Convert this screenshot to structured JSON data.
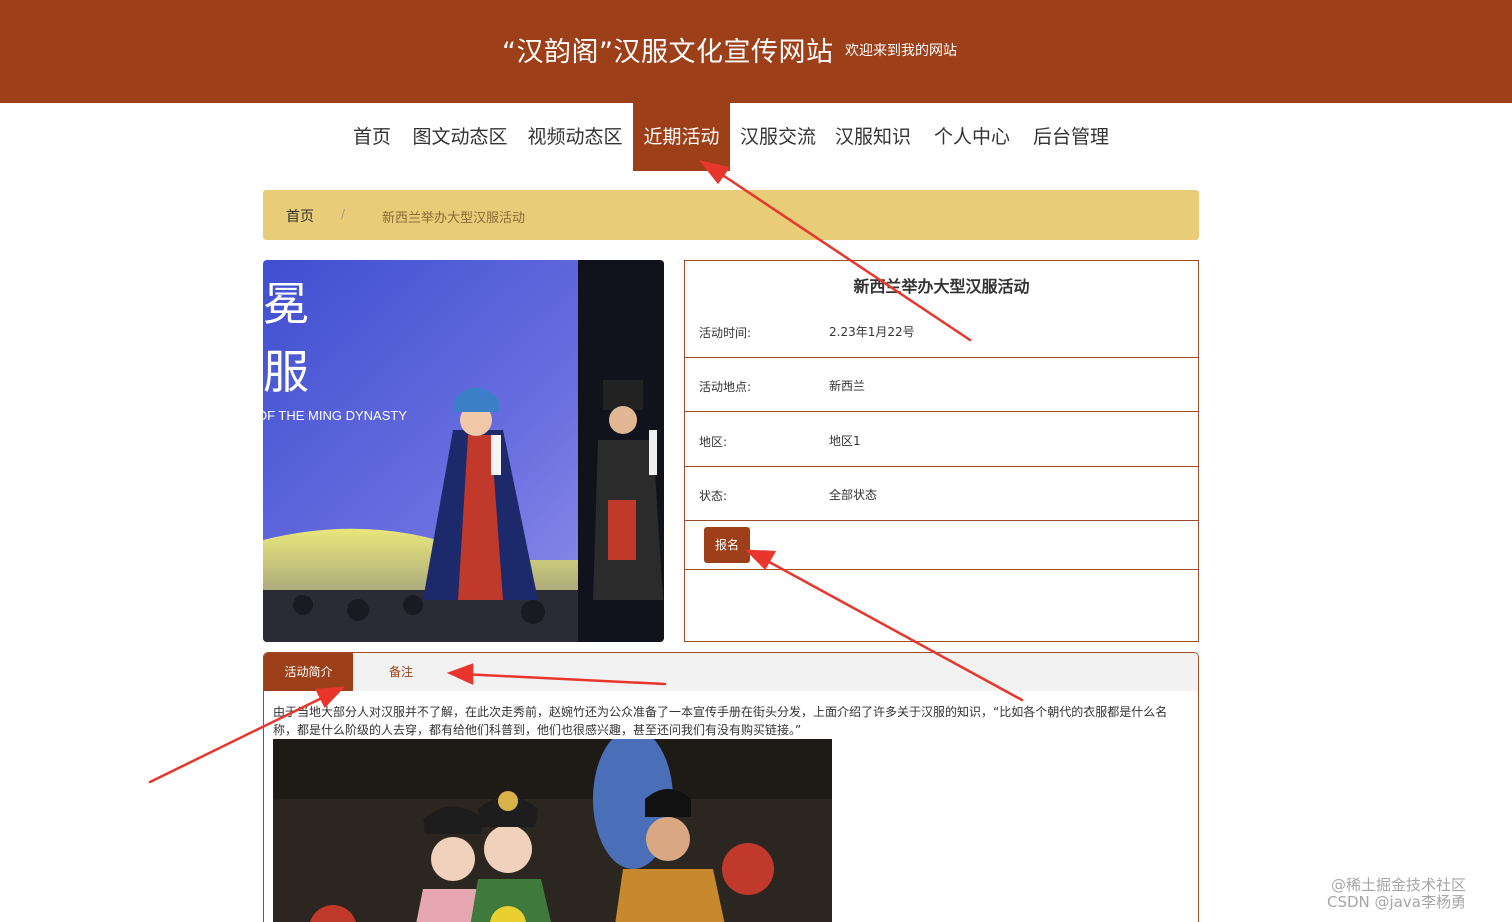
{
  "header": {
    "title": "“汉韵阁”汉服文化宣传网站",
    "welcome": "欢迎来到我的网站"
  },
  "nav": {
    "items": [
      {
        "label": "首页"
      },
      {
        "label": "图文动态区"
      },
      {
        "label": "视频动态区"
      },
      {
        "label": "近期活动",
        "active": true
      },
      {
        "label": "汉服交流"
      },
      {
        "label": "汉服知识"
      },
      {
        "label": "个人中心"
      },
      {
        "label": "后台管理"
      }
    ]
  },
  "breadcrumb": {
    "home": "首页",
    "separator": "/",
    "current": "新西兰举办大型汉服活动"
  },
  "main_image": {
    "caption_big1": "冕",
    "caption_big2": "服",
    "caption_small": "OF THE MING DYNASTY"
  },
  "detail": {
    "title": "新西兰举办大型汉服活动",
    "rows": [
      {
        "label": "活动时间:",
        "value": "2.23年1月22号"
      },
      {
        "label": "活动地点:",
        "value": "新西兰"
      },
      {
        "label": "地区:",
        "value": "地区1"
      },
      {
        "label": "状态:",
        "value": "全部状态"
      }
    ],
    "signup_label": "报名"
  },
  "tabs": {
    "items": [
      {
        "label": "活动简介",
        "active": true
      },
      {
        "label": "备注",
        "active": false
      }
    ],
    "intro_text": "由于当地大部分人对汉服并不了解，在此次走秀前，赵婉竹还为公众准备了一本宣传手册在街头分发，上面介绍了许多关于汉服的知识，“比如各个朝代的衣服都是什么名称，都是什么阶级的人去穿，都有给他们科普到，他们也很感兴趣，甚至还问我们有没有购买链接。”"
  },
  "watermark": {
    "line1": "@稀土掘金技术社区",
    "line2": "CSDN @java李杨勇"
  },
  "colors": {
    "brand": "#9d3f18",
    "breadcrumb_bg": "#e9cc78",
    "annotation": "#e8362c"
  }
}
